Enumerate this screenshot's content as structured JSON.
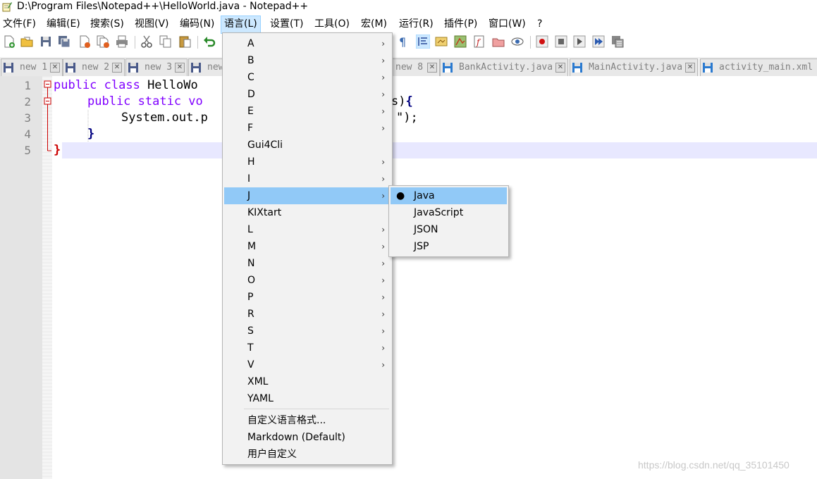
{
  "window": {
    "title": "D:\\Program Files\\Notepad++\\HelloWorld.java - Notepad++"
  },
  "menubar": [
    "文件(F)",
    "编辑(E)",
    "搜索(S)",
    "视图(V)",
    "编码(N)",
    "语言(L)",
    "设置(T)",
    "工具(O)",
    "宏(M)",
    "运行(R)",
    "插件(P)",
    "窗口(W)",
    "?"
  ],
  "tabs": [
    {
      "label": "new 1"
    },
    {
      "label": "new 2"
    },
    {
      "label": "new 3"
    },
    {
      "label": "new"
    },
    {
      "label": "new 8"
    },
    {
      "label": "BankActivity.java"
    },
    {
      "label": "MainActivity.java"
    },
    {
      "label": "activity_main.xml"
    }
  ],
  "editor": {
    "line_numbers": [
      "1",
      "2",
      "3",
      "4",
      "5"
    ],
    "line1": {
      "kw": "public class ",
      "rest": "HelloWo"
    },
    "line2": {
      "kw": "public static vo",
      "tail1": "s)",
      "tail2": "{"
    },
    "line3": {
      "rest": "System.out.p",
      "tail": "\");"
    },
    "line4": {
      "brace": "}"
    },
    "line5": {
      "brace": "}"
    }
  },
  "language_menu": {
    "items": [
      "A",
      "B",
      "C",
      "D",
      "E",
      "F",
      "Gui4Cli",
      "H",
      "I",
      "J",
      "KIXtart",
      "L",
      "M",
      "N",
      "O",
      "P",
      "R",
      "S",
      "T",
      "V",
      "XML",
      "YAML"
    ],
    "submenu_arrow": "›",
    "custom_items": [
      "自定义语言格式...",
      "Markdown (Default)",
      "用户自定义"
    ]
  },
  "j_submenu": {
    "items": [
      "Java",
      "JavaScript",
      "JSON",
      "JSP"
    ],
    "selected": "Java",
    "bullet": "●"
  },
  "watermark": "https://blog.csdn.net/qq_35101450",
  "colors": {
    "keyword": "#8000ff",
    "highlight": "#91c9f7",
    "current_line": "#e8e8ff",
    "fold_marker": "#cc0000"
  }
}
